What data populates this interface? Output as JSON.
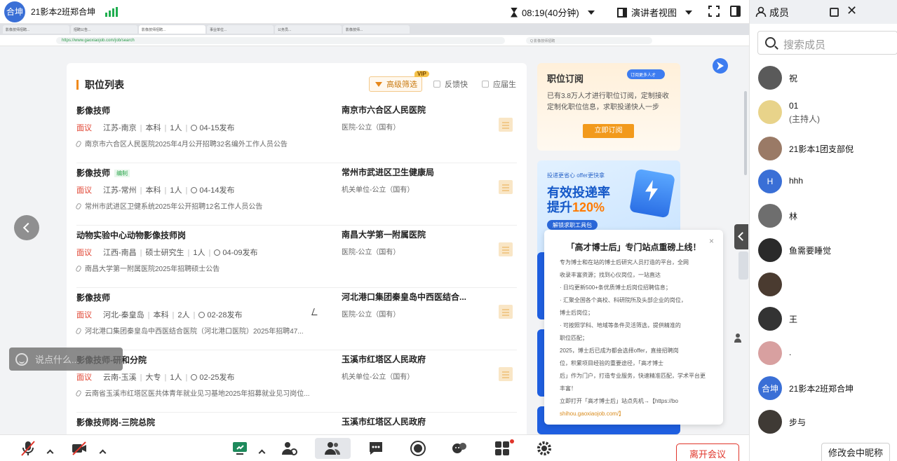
{
  "topbar": {
    "host_avatar_text": "合坤",
    "meeting_name": "21影本2班郑合坤",
    "timer": "08:19(40分钟)",
    "view_mode": "演讲者视图"
  },
  "browser": {
    "tabs": [
      "影像技师招聘...",
      "招聘公告...",
      "影像技师招聘...",
      "事业单位...",
      "公务员...",
      "影像技师..."
    ],
    "address": "https://www.gaoxiaojob.com/job/search",
    "search_box": "Q 影像技师招聘"
  },
  "job_list": {
    "title": "职位列表",
    "filter_label": "高级筛选",
    "vip_badge": "VIP",
    "checkbox1": "反馈快",
    "checkbox2": "应届生",
    "jobs": [
      {
        "name": "影像技师",
        "tag": "",
        "salary": "面议",
        "location": "江苏-南京",
        "education": "本科",
        "count": "1人",
        "date": "04-15发布",
        "desc": "南京市六合区人民医院2025年4月公开招聘32名编外工作人员公告",
        "org": "南京市六合区人民医院",
        "org_type": "医院-公立（国有）"
      },
      {
        "name": "影像技师",
        "tag": "编制",
        "salary": "面议",
        "location": "江苏-常州",
        "education": "本科",
        "count": "1人",
        "date": "04-14发布",
        "desc": "常州市武进区卫健系统2025年公开招聘12名工作人员公告",
        "org": "常州市武进区卫生健康局",
        "org_type": "机关单位-公立（国有）"
      },
      {
        "name": "动物实验中心动物影像技师岗",
        "tag": "",
        "salary": "面议",
        "location": "江西-南昌",
        "education": "硕士研究生",
        "count": "1人",
        "date": "04-09发布",
        "desc": "南昌大学第一附属医院2025年招聘硕士公告",
        "org": "南昌大学第一附属医院",
        "org_type": "医院-公立（国有）"
      },
      {
        "name": "影像技师",
        "tag": "",
        "salary": "面议",
        "location": "河北-秦皇岛",
        "education": "本科",
        "count": "2人",
        "date": "02-28发布",
        "desc": "河北港口集团秦皇岛中西医结合医院（河北港口医院）2025年招聘47...",
        "org": "河北港口集团秦皇岛中西医结合...",
        "org_type": "医院-公立（国有）"
      },
      {
        "name": "影像技师-研和分院",
        "tag": "",
        "salary": "面议",
        "location": "云南-玉溪",
        "education": "大专",
        "count": "1人",
        "date": "02-25发布",
        "desc": "云南省玉溪市红塔区医共体青年就业见习基地2025年招募就业见习岗位...",
        "org": "玉溪市红塔区人民政府",
        "org_type": "机关单位-公立（国有）"
      },
      {
        "name": "影像技师岗-三院总院",
        "tag": "",
        "salary": "",
        "location": "",
        "education": "",
        "count": "",
        "date": "",
        "desc": "",
        "org": "玉溪市红塔区人民政府",
        "org_type": ""
      }
    ]
  },
  "subscription": {
    "title": "职位订阅",
    "badge": "订阅更多人才",
    "text": "已有3.8万人才进行职位订阅，定制接收定制化职位信息，求职投递快人一步",
    "button": "立即订阅"
  },
  "promo": {
    "small": "投递更省心 offer更快拿",
    "line1": "有效投递率",
    "line2_prefix": "提升",
    "line2_highlight": "120%",
    "pill": "解锁求职工具包"
  },
  "popup": {
    "title": "「高才博士后」专门站点重磅上线！",
    "close": "×",
    "lines": [
      "专为博士和在站的博士后研究人员打造的平台，全网",
      "收录丰富资源；找到心仪岗位，一站直达",
      "· 日均更新500+条优质博士后岗位招聘信息；",
      "· 汇聚全国各个高校、科研院所及头部企业的岗位，",
      "博士后岗位；",
      "· 可按照学科、地域等条件灵活筛选，提供精准的",
      "职位匹配；",
      "2025，博士后已成为都会选择offer，直接招聘岗",
      "位，积累项目经验的重要途径，「高才博士",
      "后」作为门户，打造专业服务，快速精准匹配，学术平台更",
      "丰富！",
      "立即打开「高才博士后」站点先机→【https://bo"
    ],
    "link_tail": "shihou.gaoxiaojob.com/】"
  },
  "overlay": {
    "danmu_placeholder": "说点什么..."
  },
  "toolbar": {
    "leave_label": "离开会议"
  },
  "panel": {
    "title": "成员",
    "search_placeholder": "搜索成员",
    "members": [
      {
        "name": "祝",
        "role": "",
        "avatar_text": "",
        "avatar_color": "#5a5a5a"
      },
      {
        "name": "01",
        "role": "(主持人)",
        "avatar_text": "",
        "avatar_color": "#e8d38a"
      },
      {
        "name": "21影本1团支部倪",
        "role": "",
        "avatar_text": "",
        "avatar_color": "#9a7a66"
      },
      {
        "name": "hhh",
        "role": "",
        "avatar_text": "H",
        "avatar_color": "#3a6fd6"
      },
      {
        "name": "林",
        "role": "",
        "avatar_text": "",
        "avatar_color": "#6e6e6e"
      },
      {
        "name": "鱼需要睡觉",
        "role": "",
        "avatar_text": "",
        "avatar_color": "#2a2a2a"
      },
      {
        "name": "",
        "role": "",
        "avatar_text": "",
        "avatar_color": "#4a3b30"
      },
      {
        "name": "王",
        "role": "",
        "avatar_text": "",
        "avatar_color": "#333333"
      },
      {
        "name": ".",
        "role": "",
        "avatar_text": "",
        "avatar_color": "#d8a0a0"
      },
      {
        "name": "21影本2班郑合坤",
        "role": "",
        "avatar_text": "合坤",
        "avatar_color": "#3a6fd6"
      },
      {
        "name": "步与",
        "role": "",
        "avatar_text": "",
        "avatar_color": "#3f3a35"
      }
    ],
    "rename_button": "修改会中昵称"
  },
  "colors": {
    "accent_blue": "#3a6fd6",
    "danger_red": "#e0352b",
    "salary_red": "#e0402e",
    "orange": "#f29a1c",
    "signal_green": "#1fae4f"
  }
}
